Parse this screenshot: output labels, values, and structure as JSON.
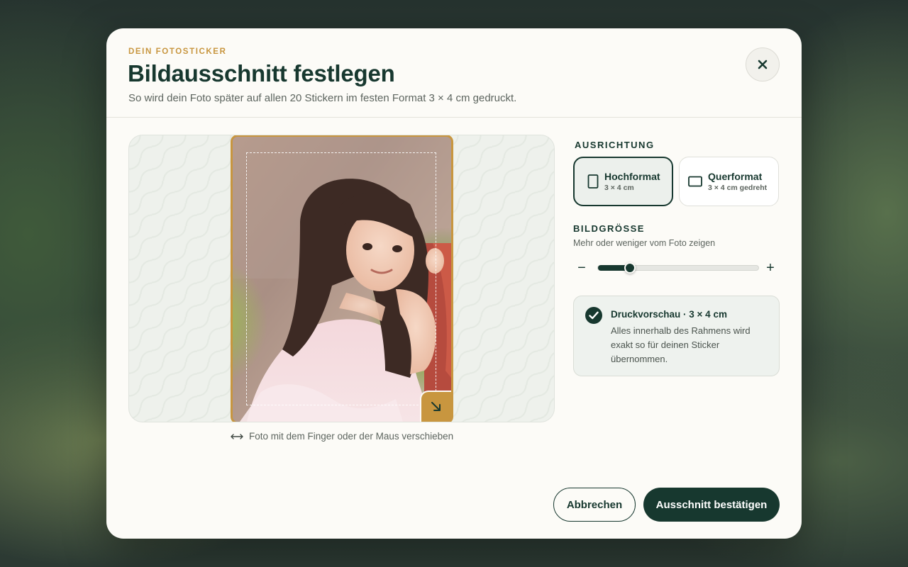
{
  "header": {
    "eyebrow": "DEIN FOTOSTICKER",
    "title": "Bildausschnitt festlegen",
    "subtitle": "So wird dein Foto später auf allen 20 Stickern im festen Format 3 × 4 cm gedruckt.",
    "close_icon": "close-icon"
  },
  "crop": {
    "hint_icon": "horizontal-arrows-icon",
    "hint": "Foto mit dem Finger oder der Maus verschieben",
    "handle_icon": "resize-arrow-icon"
  },
  "orientation": {
    "label": "AUSRICHTUNG",
    "options": [
      {
        "name": "Hochformat",
        "size": "3 × 4 cm",
        "icon": "portrait-icon",
        "selected": true
      },
      {
        "name": "Querformat",
        "size": "3 × 4 cm gedreht",
        "icon": "landscape-icon",
        "selected": false
      }
    ]
  },
  "image_size": {
    "label": "BILDGRÖSSE",
    "help": "Mehr oder weniger vom Foto zeigen",
    "minus": "−",
    "plus": "+",
    "zoom_fraction": 0.2
  },
  "preview": {
    "icon": "check-circle-icon",
    "title": "Druckvorschau · 3 × 4 cm",
    "text": "Alles innerhalb des Rahmens wird exakt so für deinen Sticker übernommen."
  },
  "actions": {
    "cancel": "Abbrechen",
    "confirm": "Ausschnitt bestätigen"
  },
  "colors": {
    "primary": "#17382f",
    "accent": "#c8963f",
    "surface": "#fcfbf7"
  }
}
